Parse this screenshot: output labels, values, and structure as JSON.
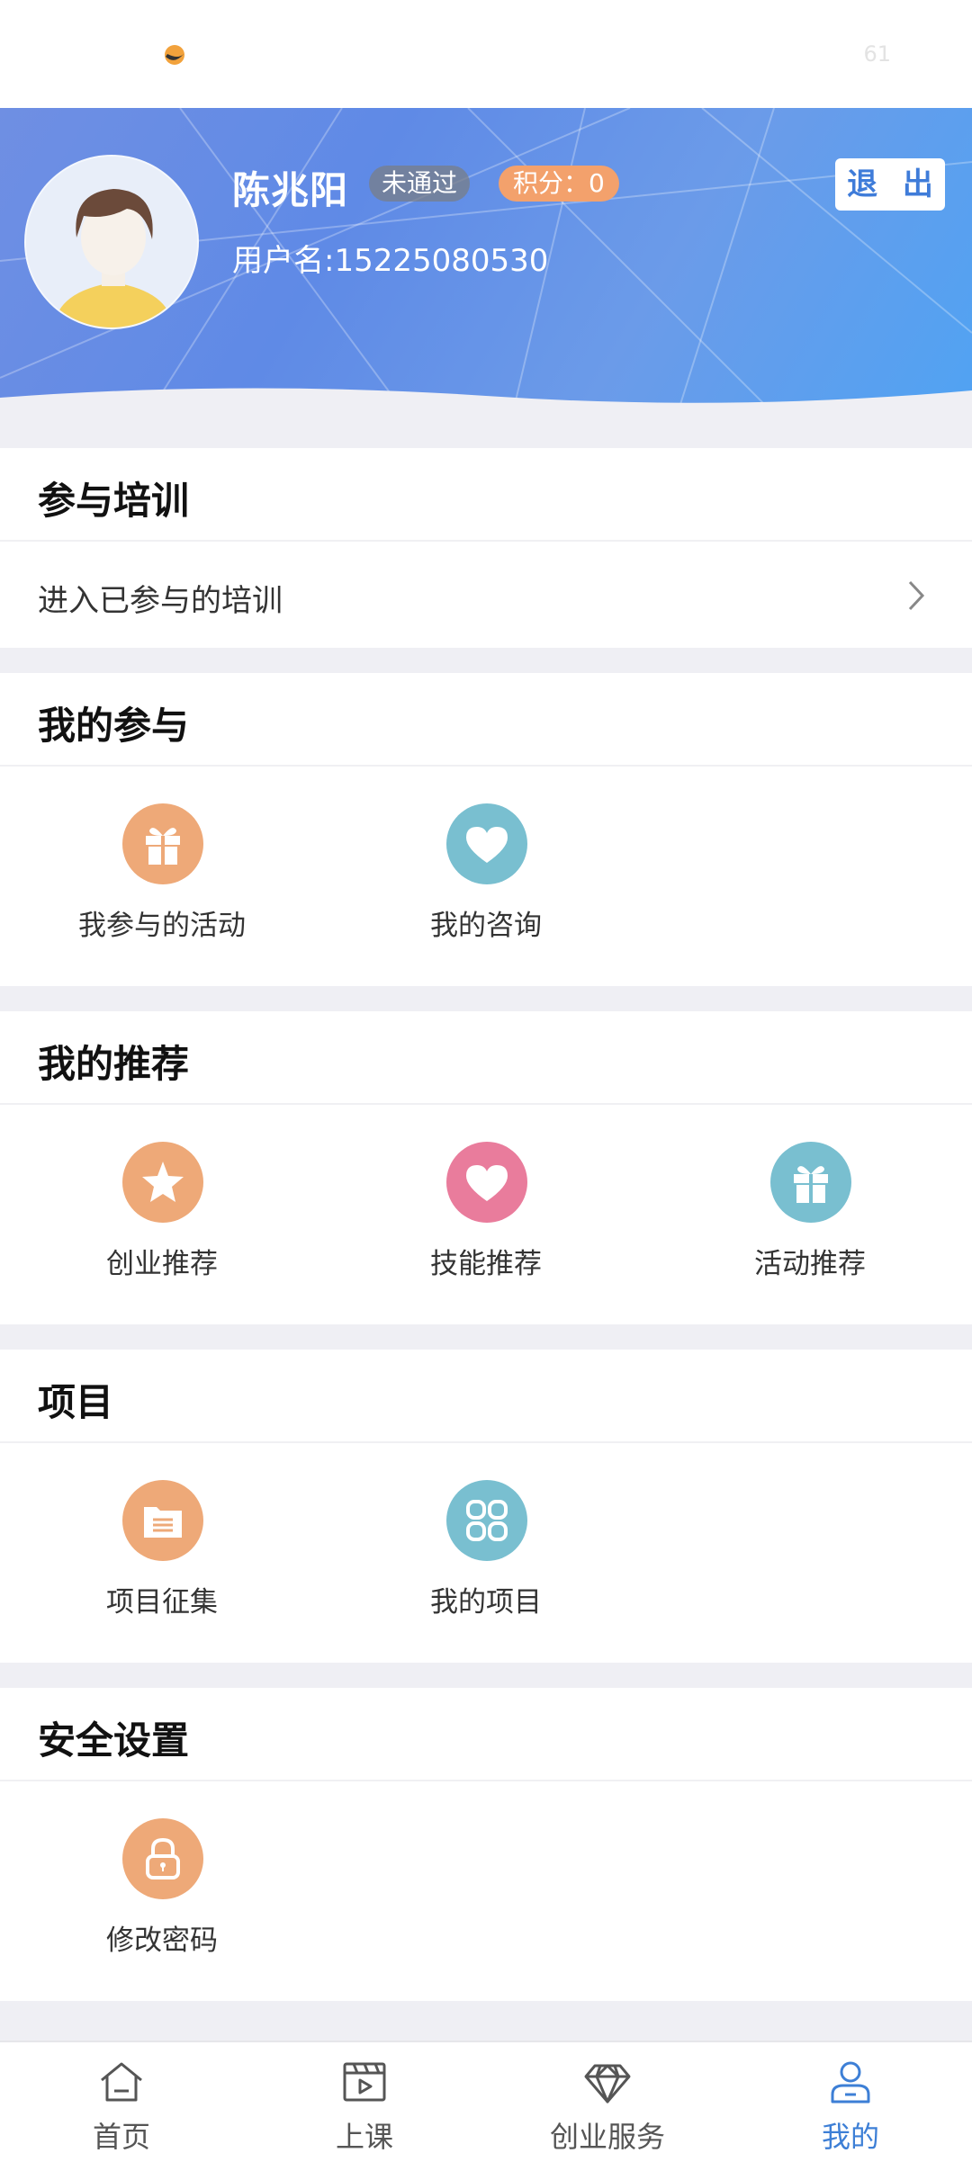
{
  "status_bar": {
    "battery": "61"
  },
  "profile": {
    "name": "陈兆阳",
    "status_badge": "未通过",
    "points": "积分：0",
    "username": "用户名:15225080530",
    "logout_label": "退 出"
  },
  "training": {
    "title": "参与培训",
    "link_label": "进入已参与的培训"
  },
  "participation": {
    "title": "我的参与",
    "items": [
      {
        "label": "我参与的活动",
        "icon": "gift-icon",
        "color": "#eea978"
      },
      {
        "label": "我的咨询",
        "icon": "heart-icon",
        "color": "#79bfd0"
      }
    ]
  },
  "recommend": {
    "title": "我的推荐",
    "items": [
      {
        "label": "创业推荐",
        "icon": "star-icon",
        "color": "#eea978"
      },
      {
        "label": "技能推荐",
        "icon": "heart-icon",
        "color": "#e97c9c"
      },
      {
        "label": "活动推荐",
        "icon": "gift-icon",
        "color": "#79bfd0"
      }
    ]
  },
  "projects": {
    "title": "项目",
    "items": [
      {
        "label": "项目征集",
        "icon": "folder-icon",
        "color": "#eea978"
      },
      {
        "label": "我的项目",
        "icon": "grid-apps-icon",
        "color": "#79bfd0"
      }
    ]
  },
  "security": {
    "title": "安全设置",
    "items": [
      {
        "label": "修改密码",
        "icon": "lock-icon",
        "color": "#eea978"
      }
    ]
  },
  "nav": {
    "items": [
      {
        "label": "首页",
        "icon": "home-icon"
      },
      {
        "label": "上课",
        "icon": "video-icon"
      },
      {
        "label": "创业服务",
        "icon": "diamond-icon"
      },
      {
        "label": "我的",
        "icon": "user-icon"
      }
    ],
    "active_color": "#3d7fd6"
  }
}
